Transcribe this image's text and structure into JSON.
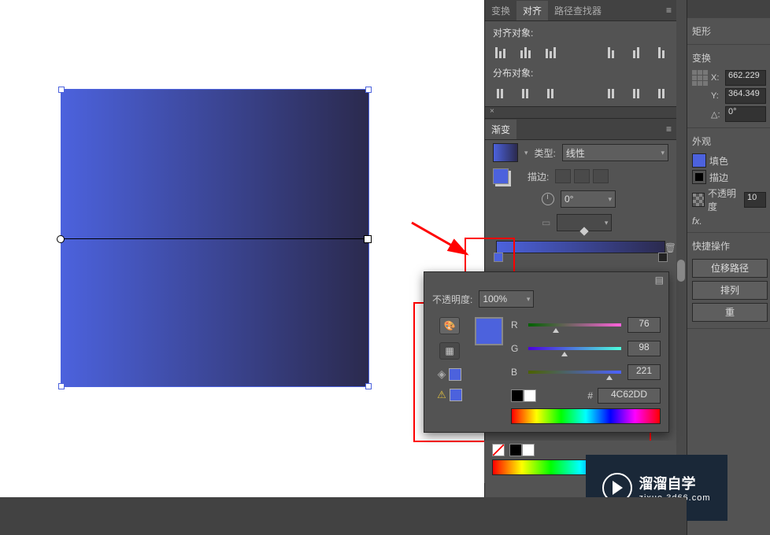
{
  "tabs_top": {
    "transform": "变换",
    "align": "对齐",
    "pathfinder": "路径查找器"
  },
  "align_panel": {
    "align_objects": "对齐对象:",
    "distribute_objects": "分布对象:"
  },
  "gradient_panel": {
    "title": "渐变",
    "type_label": "类型:",
    "type_value": "线性",
    "stroke_label": "描边:",
    "angle_value": "0°"
  },
  "color_popover": {
    "opacity_label": "不透明度:",
    "opacity_value": "100%",
    "r_label": "R",
    "r_value": "76",
    "g_label": "G",
    "g_value": "98",
    "b_label": "B",
    "b_value": "221",
    "hash": "#",
    "hex": "4C62DD"
  },
  "right": {
    "shape_title": "矩形",
    "transform_title": "变换",
    "x_label": "X:",
    "x_value": "662.229",
    "y_label": "Y:",
    "y_value": "364.349",
    "angle_label": "△:",
    "angle_value": "0°",
    "appearance_title": "外观",
    "fill_label": "填色",
    "stroke_label": "描边",
    "opacity_label": "不透明度",
    "opacity_value": "10",
    "fx_label": "fx.",
    "quick_title": "快捷操作",
    "offset_path": "位移路径",
    "arrange": "排列",
    "reset": "重"
  },
  "watermark": {
    "line1": "溜溜自学",
    "line2": "zixue.3d66.com"
  },
  "colors": {
    "swatch": "#4c62dd"
  }
}
